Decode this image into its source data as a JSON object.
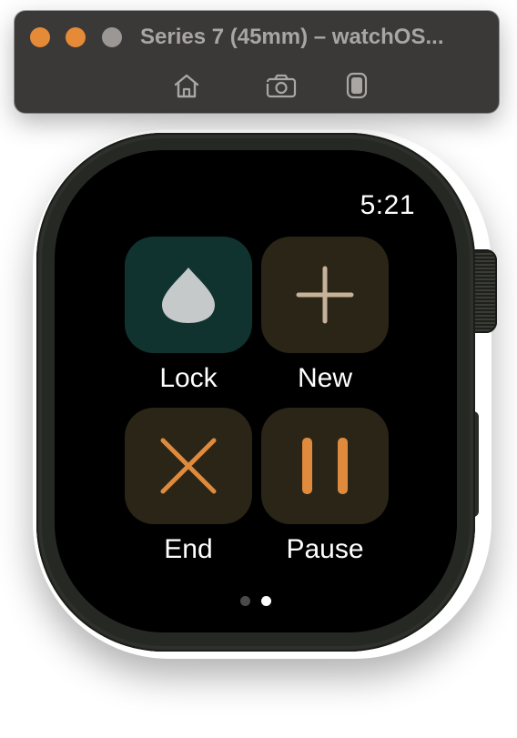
{
  "window": {
    "title": "Series 7 (45mm) – watchOS...",
    "traffic_lights": {
      "close_color": "#e58a37",
      "minimize_color": "#e58a37",
      "zoom_color": "#9a9794"
    },
    "toolbar": [
      {
        "name": "home-button",
        "icon": "home-icon"
      },
      {
        "name": "screenshot-button",
        "icon": "camera-icon"
      },
      {
        "name": "rotate-button",
        "icon": "watch-device-icon"
      }
    ]
  },
  "watch": {
    "time": "5:21",
    "actions": [
      {
        "label": "Lock",
        "icon": "water-drop-icon",
        "tile_color": "#11332f",
        "icon_color": "#c5c9c9"
      },
      {
        "label": "New",
        "icon": "plus-icon",
        "tile_color": "#2a2517",
        "icon_color": "#c7b299"
      },
      {
        "label": "End",
        "icon": "close-icon",
        "tile_color": "#2a2517",
        "icon_color": "#df8a3c"
      },
      {
        "label": "Pause",
        "icon": "pause-icon",
        "tile_color": "#2a2517",
        "icon_color": "#df8a3c"
      }
    ],
    "pager": {
      "pages": 2,
      "current": 2,
      "active_color": "#ffffff",
      "inactive_color": "#4a4a4a"
    }
  }
}
